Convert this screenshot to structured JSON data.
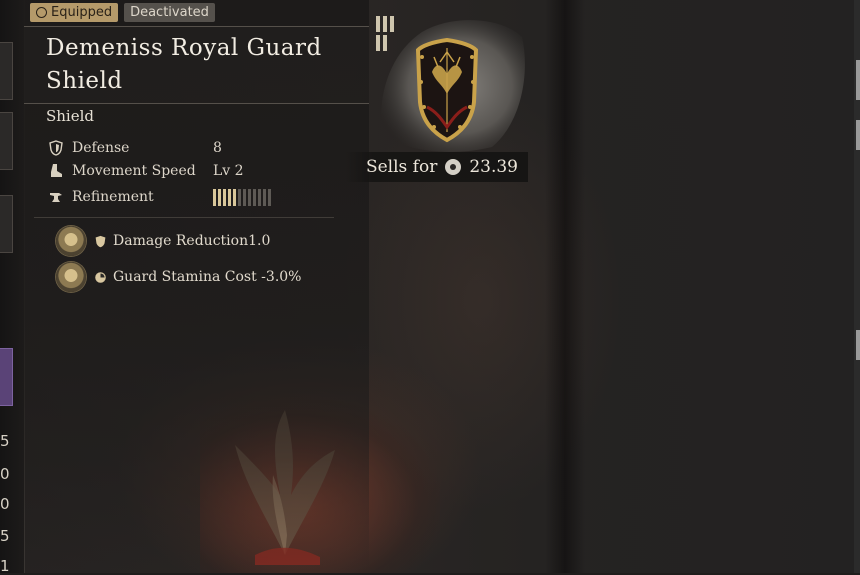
{
  "tags": {
    "equipped": "Equipped",
    "deactivated": "Deactivated"
  },
  "item": {
    "name": "Demeniss Royal Guard Shield",
    "type": "Shield",
    "stats": [
      {
        "label": "Defense",
        "value": "8",
        "icon": "shield-icon"
      },
      {
        "label": "Movement Speed",
        "value": "Lv 2",
        "icon": "boot-icon"
      },
      {
        "label": "Refinement",
        "value": "",
        "icon": "anvil-icon"
      }
    ],
    "refinement_level": 5,
    "refinement_max": 12,
    "perks": [
      {
        "text": "Damage Reduction1.0",
        "icon": "shield-small-icon"
      },
      {
        "text": "Guard Stamina Cost -3.0%",
        "icon": "stamina-icon"
      }
    ]
  },
  "sell": {
    "label": "Sells for",
    "value": "23.39",
    "icon": "coin-icon"
  },
  "sidebar_numbers": [
    "5",
    "0",
    "0",
    "5",
    "1"
  ],
  "colors": {
    "equipped_tag": "#b59a6a",
    "deactivated_tag": "#55514c",
    "refinement_on": "#d9c79a",
    "refinement_off": "#5e5a55",
    "shield_gold": "#c9a24a",
    "shield_red": "#8a1e1a"
  }
}
